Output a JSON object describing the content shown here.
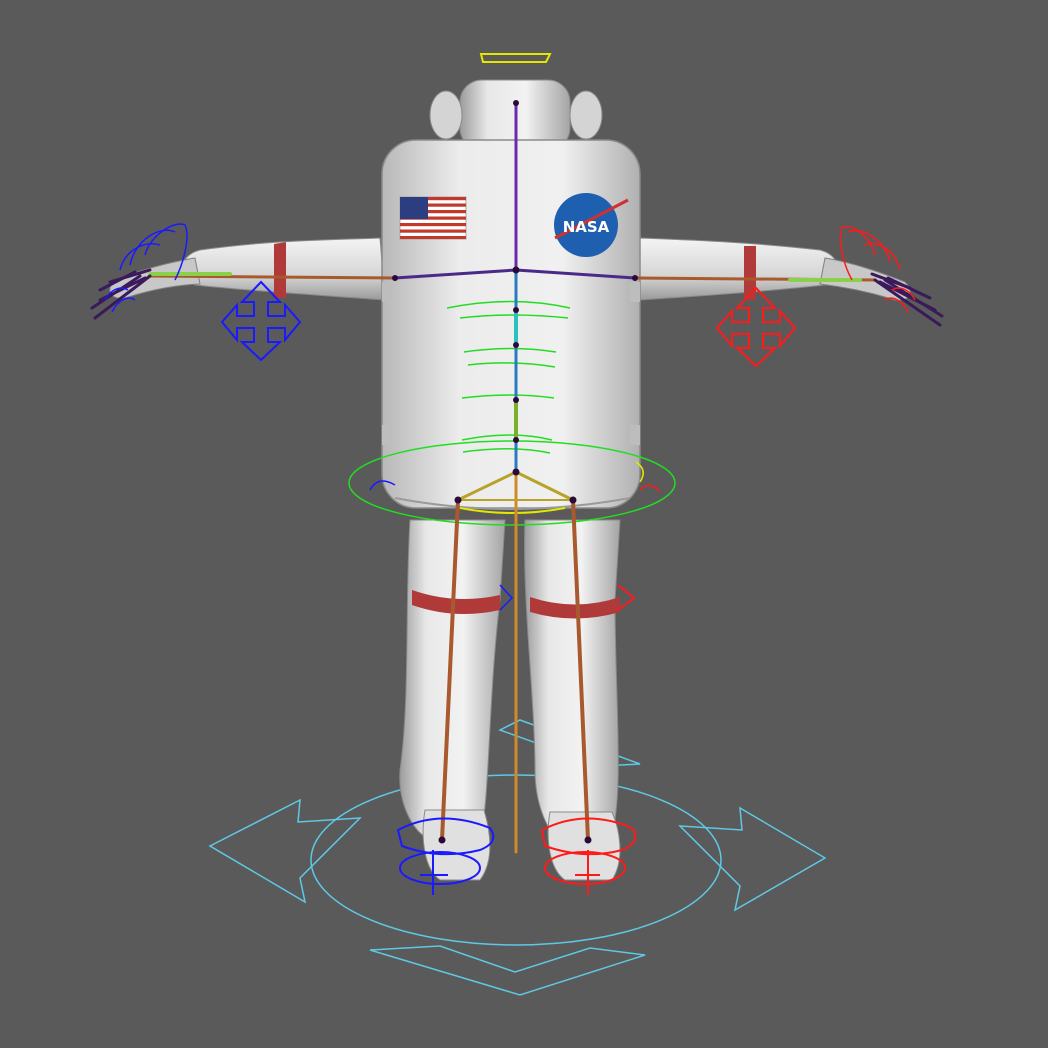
{
  "viewport": {
    "background": "#5a5a5a"
  },
  "model": {
    "suit_color": "#e6e6e6",
    "suit_shadow": "#9a9a9a",
    "band_color": "#b03a3a",
    "logo_text": "NASA"
  },
  "rig_colors": {
    "left_side": "#1a1aff",
    "right_side": "#ff1a1a",
    "spine": "#22dd22",
    "root_control": "#5ec8e6",
    "head_control": "#e6e600",
    "hip_control": "#e6e600",
    "bone": "#a85a2e",
    "spine_bone": "#6a2aa8",
    "joint": "#2a0a3a"
  },
  "icons": [
    "move-arrows-icon",
    "root-control-icon",
    "head-control-icon",
    "flag-icon",
    "logo-icon"
  ]
}
